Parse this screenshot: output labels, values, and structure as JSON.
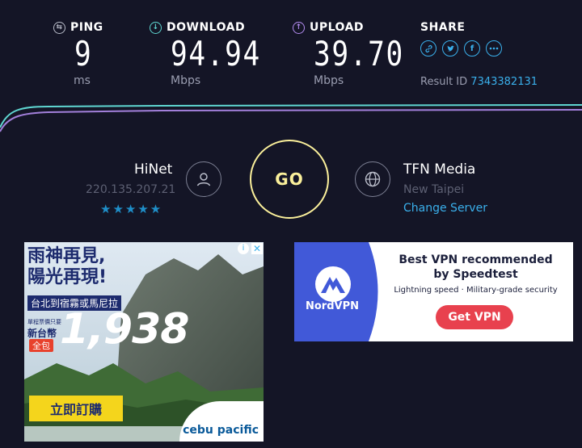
{
  "ping": {
    "label": "PING",
    "value": "9",
    "unit": "ms"
  },
  "download": {
    "label": "DOWNLOAD",
    "value": "94.94",
    "unit": "Mbps"
  },
  "upload": {
    "label": "UPLOAD",
    "value": "39.70",
    "unit": "Mbps"
  },
  "share": {
    "label": "SHARE",
    "icons": [
      "link-icon",
      "twitter-icon",
      "facebook-icon",
      "more-icon"
    ]
  },
  "result": {
    "label": "Result ID",
    "id": "7343382131"
  },
  "isp": {
    "name": "HiNet",
    "ip": "220.135.207.21",
    "rating": 5
  },
  "go_label": "GO",
  "server": {
    "name": "TFN Media",
    "location": "New Taipei",
    "change_label": "Change Server"
  },
  "ad_cebu": {
    "headline1": "雨神再見,",
    "headline2": "陽光再現!",
    "route": "台北到宿霧或馬尼拉",
    "price_note": "單程票價只要",
    "currency": "新台幣",
    "all_in": "全包",
    "price": "1,938",
    "cta": "立即訂購",
    "brand": "cebu pacific"
  },
  "ad_vpn": {
    "brand": "NordVPN",
    "title": "Best VPN recommended",
    "subtitle": "by Speedtest",
    "features": "Lightning speed · Military-grade security",
    "cta": "Get VPN"
  },
  "colors": {
    "background": "#141526",
    "download": "#5fd6d1",
    "upload": "#b38cf0",
    "go": "#fbf09b",
    "link": "#3ab0ec"
  }
}
